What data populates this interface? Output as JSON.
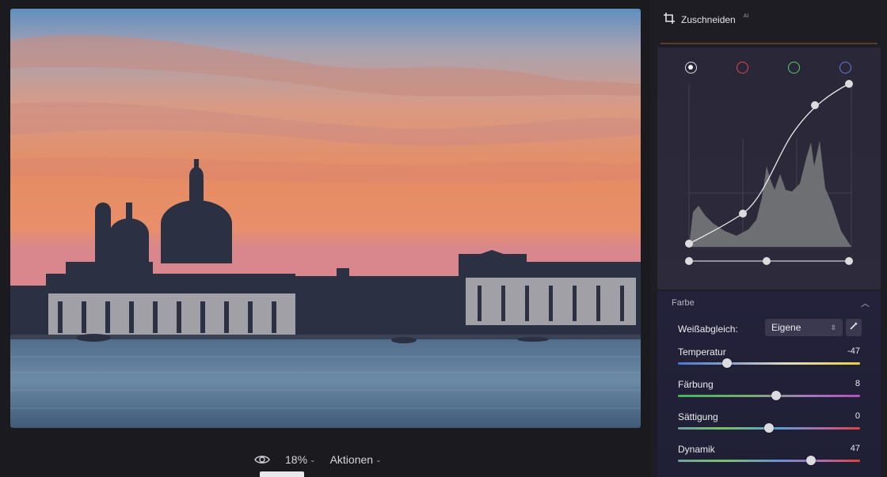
{
  "panel": {
    "crop_label": "Zuschneiden",
    "crop_badge": "AI",
    "color_section_title": "Farbe",
    "white_balance": {
      "label": "Weißabgleich:",
      "value": "Eigene"
    },
    "sliders": [
      {
        "label": "Temperatur",
        "value": "-47",
        "level": 0.27
      },
      {
        "label": "Färbung",
        "value": "8",
        "level": 0.54
      },
      {
        "label": "Sättigung",
        "value": "0",
        "level": 0.5
      },
      {
        "label": "Dynamik",
        "value": "47",
        "level": 0.73
      }
    ],
    "curve_channels": [
      "white-channel-icon",
      "red-channel-icon",
      "green-channel-icon",
      "blue-channel-icon"
    ]
  },
  "toolbar": {
    "zoom": "18%",
    "actions": "Aktionen"
  },
  "colors": {
    "panel_bg": "#1e1d24",
    "accent_red": "#e1454b",
    "accent_green": "#4fd16c",
    "accent_blue": "#6877d8"
  }
}
